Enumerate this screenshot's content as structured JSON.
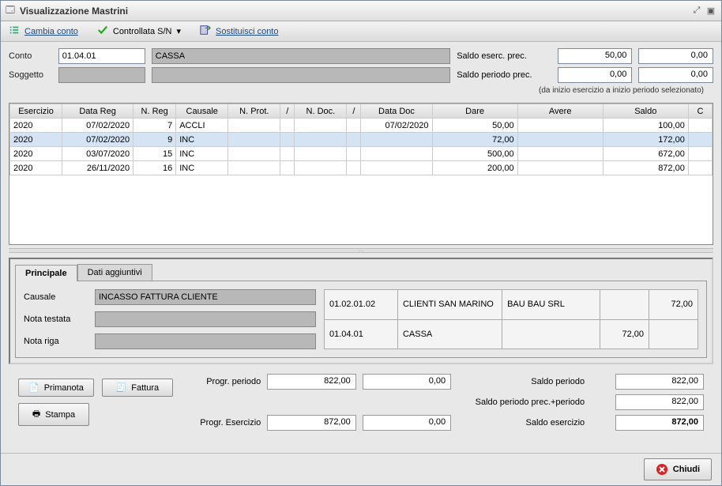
{
  "window": {
    "title": "Visualizzazione Mastrini"
  },
  "toolbar": {
    "cambia": "Cambia conto",
    "controllata": "Controllata S/N",
    "sostituisci": "Sostituisci conto"
  },
  "header": {
    "conto_label": "Conto",
    "conto_code": "01.04.01",
    "conto_desc": "CASSA",
    "soggetto_label": "Soggetto",
    "saldo_eserc_label": "Saldo eserc. prec.",
    "saldo_eserc_v1": "50,00",
    "saldo_eserc_v2": "0,00",
    "saldo_periodo_label": "Saldo periodo prec.",
    "saldo_periodo_v1": "0,00",
    "saldo_periodo_v2": "0,00",
    "hint": "(da inizio esercizio a inizio periodo selezionato)"
  },
  "grid": {
    "cols": [
      "Esercizio",
      "Data Reg",
      "N. Reg",
      "Causale",
      "N. Prot.",
      "/",
      "N. Doc.",
      "/",
      "Data Doc",
      "Dare",
      "Avere",
      "Saldo",
      "C"
    ],
    "rows": [
      {
        "ex": "2020",
        "dreg": "07/02/2020",
        "nreg": "7",
        "caus": "ACCLI",
        "nprot": "",
        "s1": "",
        "ndoc": "",
        "s2": "",
        "ddoc": "07/02/2020",
        "dare": "50,00",
        "avere": "",
        "saldo": "100,00",
        "c": ""
      },
      {
        "ex": "2020",
        "dreg": "07/02/2020",
        "nreg": "9",
        "caus": "INC",
        "nprot": "",
        "s1": "",
        "ndoc": "",
        "s2": "",
        "ddoc": "",
        "dare": "72,00",
        "avere": "",
        "saldo": "172,00",
        "c": "",
        "sel": true
      },
      {
        "ex": "2020",
        "dreg": "03/07/2020",
        "nreg": "15",
        "caus": "INC",
        "nprot": "",
        "s1": "",
        "ndoc": "",
        "s2": "",
        "ddoc": "",
        "dare": "500,00",
        "avere": "",
        "saldo": "672,00",
        "c": ""
      },
      {
        "ex": "2020",
        "dreg": "26/11/2020",
        "nreg": "16",
        "caus": "INC",
        "nprot": "",
        "s1": "",
        "ndoc": "",
        "s2": "",
        "ddoc": "",
        "dare": "200,00",
        "avere": "",
        "saldo": "872,00",
        "c": ""
      }
    ]
  },
  "tabs": {
    "principale": "Principale",
    "dati": "Dati aggiuntivi"
  },
  "detail": {
    "causale_label": "Causale",
    "causale_val": "INCASSO FATTURA CLIENTE",
    "nota_testata_label": "Nota testata",
    "nota_riga_label": "Nota riga",
    "rows": [
      {
        "code": "01.02.01.02",
        "desc": "CLIENTI SAN MARINO",
        "ref": "BAU BAU SRL",
        "dare": "",
        "avere": "72,00"
      },
      {
        "code": "01.04.01",
        "desc": "CASSA",
        "ref": "",
        "dare": "72,00",
        "avere": ""
      }
    ]
  },
  "buttons": {
    "primanota": "Primanota",
    "fattura": "Fattura",
    "stampa": "Stampa",
    "chiudi": "Chiudi"
  },
  "totals": {
    "progr_periodo_label": "Progr. periodo",
    "progr_periodo_v1": "822,00",
    "progr_periodo_v2": "0,00",
    "saldo_periodo_label": "Saldo periodo",
    "saldo_periodo_v": "822,00",
    "saldo_pp_label": "Saldo periodo prec.+periodo",
    "saldo_pp_v": "822,00",
    "progr_eserc_label": "Progr. Esercizio",
    "progr_eserc_v1": "872,00",
    "progr_eserc_v2": "0,00",
    "saldo_eserc_label": "Saldo esercizio",
    "saldo_eserc_v": "872,00"
  }
}
